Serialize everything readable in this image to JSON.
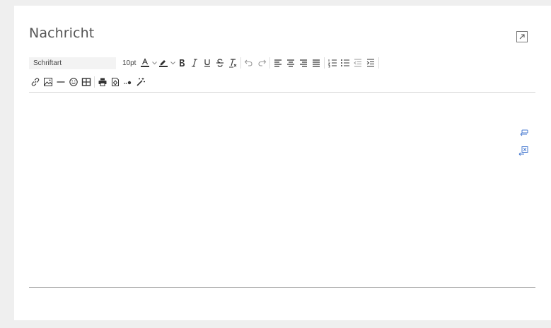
{
  "editor": {
    "label": "Nachricht",
    "font_family_value": "Schriftart",
    "font_size_value": "10pt",
    "body_text": ""
  },
  "icons": {
    "expand": "expand-icon",
    "link": "link-icon",
    "image": "image-icon",
    "horizontal_rule": "horizontal-rule-icon",
    "emoji": "emoji-icon",
    "table": "table-icon",
    "print": "print-icon",
    "template": "template-icon",
    "special_char": "special-character-icon",
    "magic": "magic-wand-icon",
    "insert_reply": "insert-reply-icon",
    "remove_reply": "remove-reply-icon"
  },
  "colors": {
    "background": "#efefef",
    "card": "#ffffff",
    "text_color_underline": "#333333",
    "highlight_underline": "#333333"
  }
}
